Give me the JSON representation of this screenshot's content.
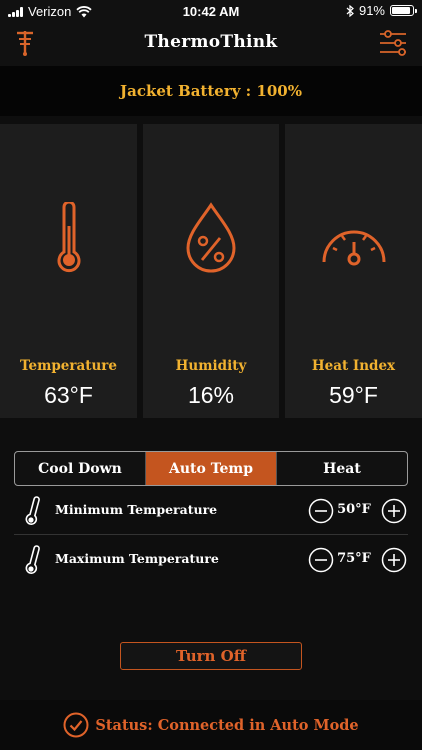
{
  "statusbar": {
    "carrier": "Verizon",
    "time": "10:42 AM",
    "battery": "91%",
    "battery_level": 0.91
  },
  "header": {
    "title": "ThermoThink"
  },
  "jacket": {
    "battery_label": "Jacket Battery : 100%"
  },
  "cards": [
    {
      "label": "Temperature",
      "value": "63°F",
      "icon": "thermometer-icon"
    },
    {
      "label": "Humidity",
      "value": "16%",
      "icon": "humidity-drop-icon"
    },
    {
      "label": "Heat Index",
      "value": "59°F",
      "icon": "gauge-icon"
    }
  ],
  "modes": {
    "items": [
      "Cool Down",
      "Auto Temp",
      "Heat"
    ],
    "selected": "Auto Temp"
  },
  "settings": {
    "min": {
      "label": "Minimum Temperature",
      "value": "50°F"
    },
    "max": {
      "label": "Maximum Temperature",
      "value": "75°F"
    }
  },
  "turn_off_label": "Turn Off",
  "status": {
    "text": "Status: Connected in Auto Mode"
  },
  "colors": {
    "accent": "#e0632a",
    "label_gold": "#f2b230",
    "active_segment": "#c4551f"
  }
}
